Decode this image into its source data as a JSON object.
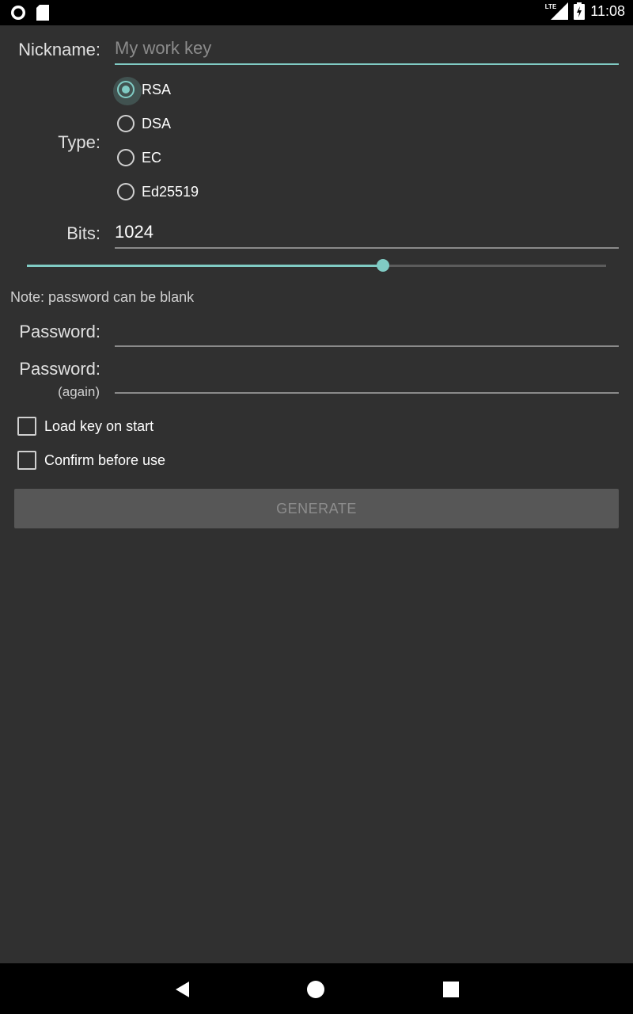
{
  "status_bar": {
    "time": "11:08",
    "network": "LTE",
    "icons": [
      "notification-circle-icon",
      "sd-card-icon",
      "signal-icon",
      "battery-charging-icon"
    ]
  },
  "form": {
    "nickname": {
      "label": "Nickname:",
      "placeholder": "My work key",
      "value": ""
    },
    "type": {
      "label": "Type:",
      "options": [
        "RSA",
        "DSA",
        "EC",
        "Ed25519"
      ],
      "selected": "RSA"
    },
    "bits": {
      "label": "Bits:",
      "value": "1024",
      "slider_fraction": 0.615
    },
    "note": "Note: password can be blank",
    "password": {
      "label": "Password:",
      "value": ""
    },
    "password_again": {
      "label": "Password:",
      "sublabel": "(again)",
      "value": ""
    },
    "load_on_start": {
      "label": "Load key on start",
      "checked": false
    },
    "confirm_before_use": {
      "label": "Confirm before use",
      "checked": false
    },
    "generate_label": "GENERATE"
  },
  "colors": {
    "accent": "#80cbc4",
    "background": "#303030",
    "button_disabled": "#575757"
  }
}
